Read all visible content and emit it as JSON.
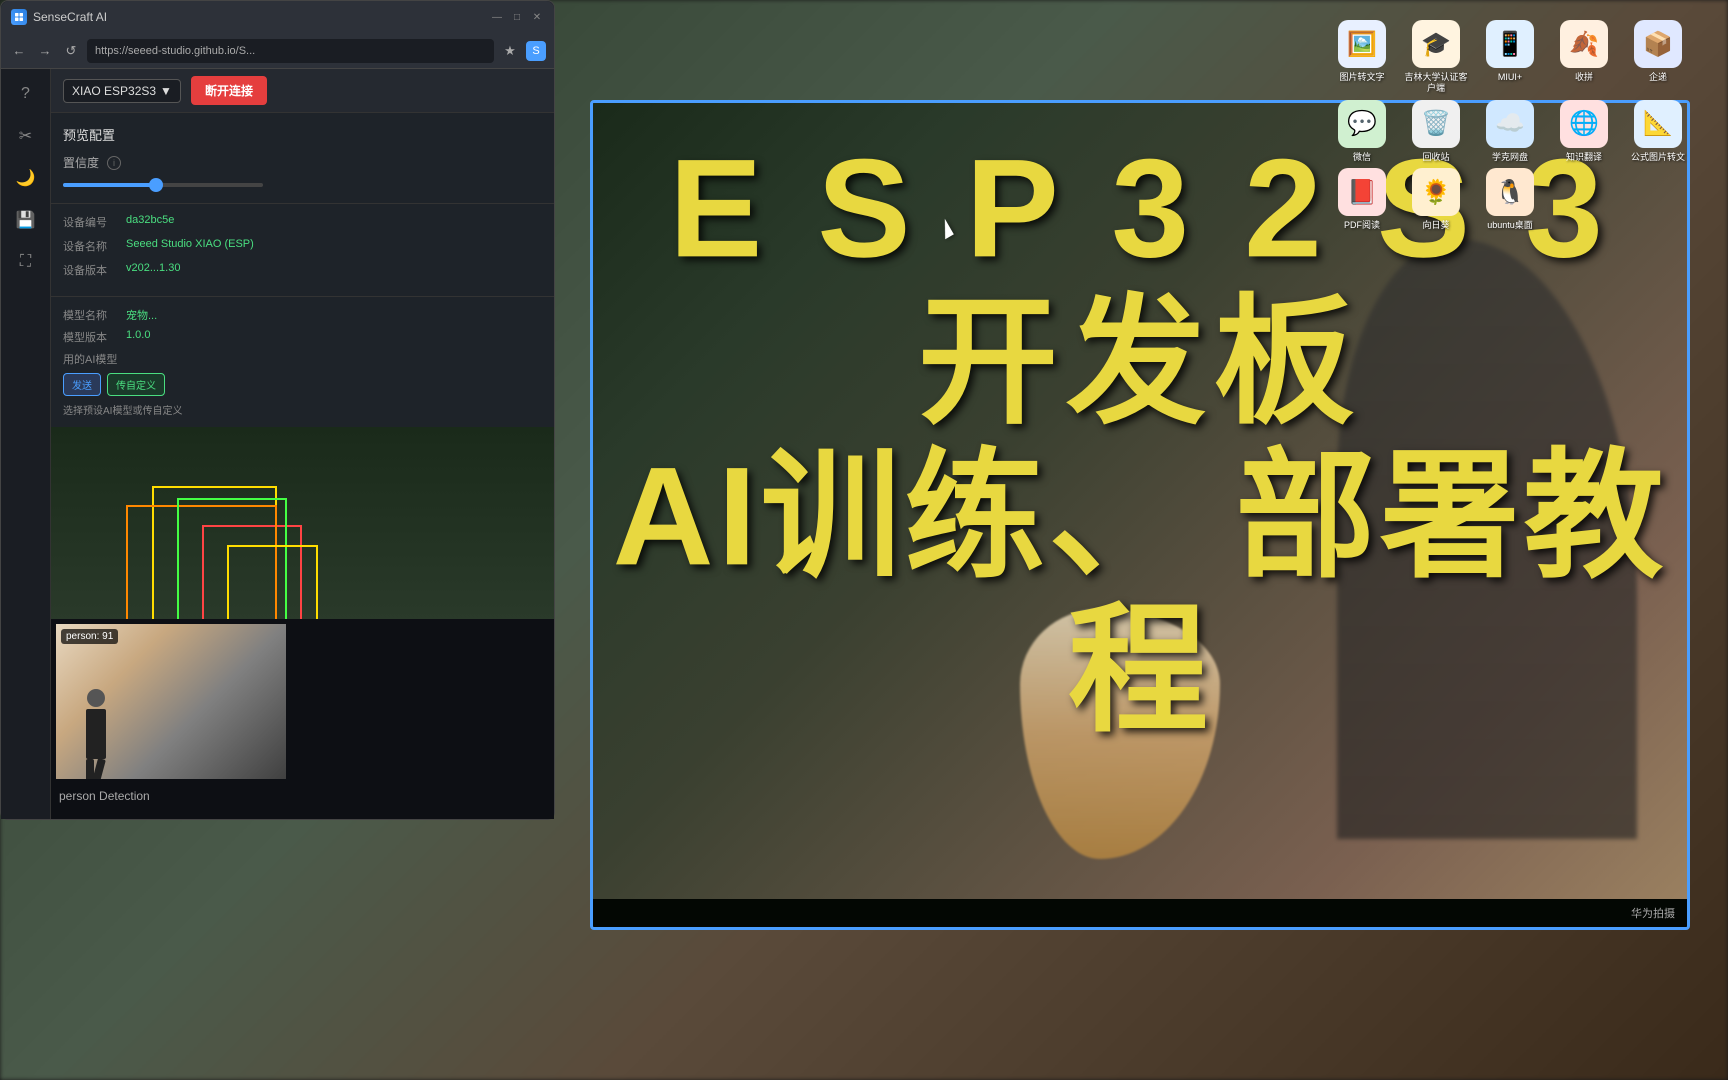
{
  "window": {
    "title": "SenseCraft AI",
    "url": "https://seeed-studio.github.io/S...",
    "controls": [
      "—",
      "□",
      "✕"
    ]
  },
  "toolbar": {
    "device": "XIAO ESP32S3",
    "connect_btn": "断开连接",
    "icons": [
      "?",
      "✂",
      "🌙",
      "💾",
      "⛶"
    ]
  },
  "preview_config": {
    "label": "预览配置",
    "confidence_label": "置信度",
    "confidence_value": "45"
  },
  "device_info": {
    "rows": [
      {
        "key": "设备编号",
        "value": "da32bc5e"
      },
      {
        "key": "设备名称",
        "value": "Seeed Studio XIAO (ESP)"
      },
      {
        "key": "设备版本",
        "value": "v202...1.30"
      }
    ]
  },
  "model_info": {
    "rows": [
      {
        "key": "模型名称",
        "value": "宠物..."
      },
      {
        "key": "模型版本",
        "value": "1.0.0"
      }
    ],
    "ai_label": "用的AI模型",
    "actions": [
      "发送",
      "传自定义"
    ]
  },
  "ai_model_section": {
    "label": "选择预设AI模型或传自定义"
  },
  "detection": {
    "badge": "person: 91",
    "label": "person Detection"
  },
  "big_title": {
    "line1": "E S P 3 2 S 3  开发板",
    "line2": "AI训练、 部署教程"
  },
  "monitor": {
    "brand": "华为拍摄"
  },
  "desktop_icons": [
    {
      "label": "图片转文字",
      "color": "#4a9eff",
      "emoji": "🖼"
    },
    {
      "label": "吉林大学认证客户端",
      "color": "#ff8800",
      "emoji": "🎓"
    },
    {
      "label": "MIUI+",
      "color": "#4488ff",
      "emoji": "📱"
    },
    {
      "label": "收拼",
      "color": "#ff6644",
      "emoji": "🍂"
    },
    {
      "label": "企递",
      "color": "#4466ff",
      "emoji": "📦"
    },
    {
      "label": "微信",
      "color": "#44aa44",
      "emoji": "💬"
    },
    {
      "label": "回收站",
      "color": "#aaaaaa",
      "emoji": "🗑"
    },
    {
      "label": "学克网盘",
      "color": "#4488ff",
      "emoji": "☁"
    },
    {
      "label": "知识翻译",
      "color": "#ff4444",
      "emoji": "🌐"
    },
    {
      "label": "公式图片转文",
      "color": "#4488ff",
      "emoji": "📐"
    },
    {
      "label": "PDF阅读",
      "color": "#ff4444",
      "emoji": "📕"
    },
    {
      "label": "向日葵",
      "color": "#ff8800",
      "emoji": "🌻"
    },
    {
      "label": "ubuntu桌面",
      "color": "#ff6600",
      "emoji": "🐧"
    }
  ]
}
